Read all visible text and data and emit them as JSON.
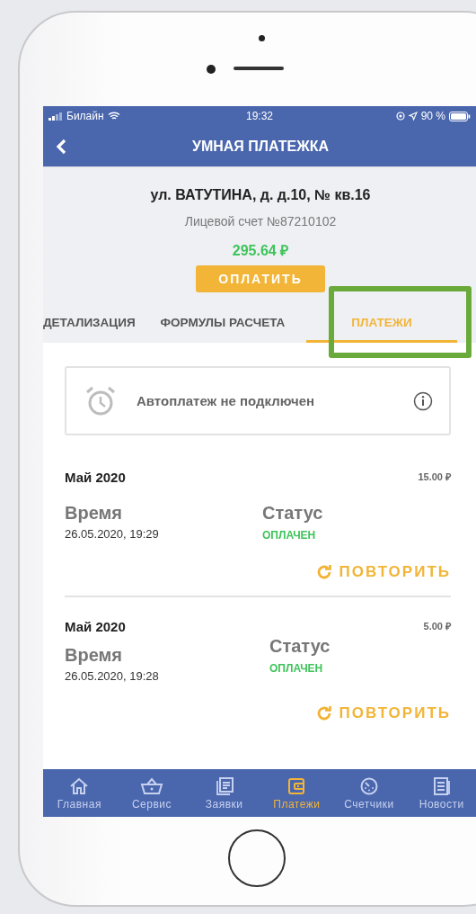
{
  "status_bar": {
    "carrier": "Билайн",
    "time": "19:32",
    "battery": "90 %"
  },
  "header": {
    "title": "УМНАЯ ПЛАТЕЖКА"
  },
  "account": {
    "address": "ул. ВАТУТИНА, д. д.10, № кв.16",
    "account_number": "Лицевой счет №87210102",
    "balance": "295.64 ₽",
    "pay_button": "ОПЛАТИТЬ"
  },
  "tabs": [
    {
      "label": "ДЕТАЛИЗАЦИЯ",
      "selected": false
    },
    {
      "label": "ФОРМУЛЫ РАСЧЕТА",
      "selected": false
    },
    {
      "label": "ПЛАТЕЖИ",
      "selected": true
    }
  ],
  "autopay": {
    "text": "Автоплатеж не подключен"
  },
  "payments": [
    {
      "month": "Май 2020",
      "amount": "15.00 ₽",
      "time_label": "Время",
      "time": "26.05.2020, 19:29",
      "status_label": "Статус",
      "status": "ОПЛАЧЕН",
      "action": "ПОВТОРИТЬ"
    },
    {
      "month": "Май 2020",
      "amount": "5.00 ₽",
      "time_label": "Время",
      "time": "26.05.2020, 19:28",
      "status_label": "Статус",
      "status": "ОПЛАЧЕН",
      "action": "ПОВТОРИТЬ"
    }
  ],
  "bottom_nav": [
    {
      "kind": "home",
      "label": "Главная",
      "selected": false
    },
    {
      "kind": "basket",
      "label": "Сервис",
      "selected": false
    },
    {
      "kind": "requests",
      "label": "Заявки",
      "selected": false
    },
    {
      "kind": "wallet",
      "label": "Платежи",
      "selected": true
    },
    {
      "kind": "meter",
      "label": "Счетчики",
      "selected": false
    },
    {
      "kind": "news",
      "label": "Новости",
      "selected": false
    }
  ]
}
